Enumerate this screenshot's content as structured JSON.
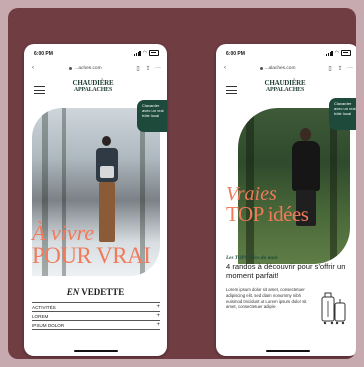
{
  "phones": [
    {
      "status": {
        "time": "6:00 PM"
      },
      "browser": {
        "url": "...aches.com",
        "back": "‹",
        "menu": "···"
      },
      "logo": {
        "line1": "CHAUDIÈRE",
        "line2": "APPALACHES"
      },
      "chat_badge": {
        "text": "Clavarder avec un vrai hôte local"
      },
      "hero": {
        "line1": "À vivre",
        "line2": "POUR VRAI"
      },
      "section": {
        "prefix": "EN",
        "title": "VEDETTE"
      },
      "accordion": [
        {
          "label": "ACTIVITÉS",
          "icon": "+"
        },
        {
          "label": "LOREM",
          "icon": "+"
        },
        {
          "label": "IPSUM DOLOR",
          "icon": "+"
        }
      ]
    },
    {
      "status": {
        "time": "6:00 PM"
      },
      "browser": {
        "url": "...alaches.com",
        "back": "‹",
        "menu": "···"
      },
      "logo": {
        "line1": "CHAUDIÈRE",
        "line2": "APPALACHES"
      },
      "chat_badge": {
        "text": "Clavarder avec un vrai hôte local"
      },
      "hero": {
        "line1": "Vraies",
        "line2": "TOP idées"
      },
      "article": {
        "label": "Les TOPS idées du mois",
        "title": "4 randos à découvrir pour s'offrir un moment parfait!",
        "body": "Lorem ipsum dolor sit amet, consectetuer adipiscing elit, sed diam nonummy nibh euismod tincidunt ut Lorem ipsum dolor sit amet, consectetuer adipis-"
      }
    }
  ],
  "colors": {
    "accent_coral": "#f07a5a",
    "brand_green": "#1e4a3c",
    "canvas_bg": "#6f3d42"
  }
}
